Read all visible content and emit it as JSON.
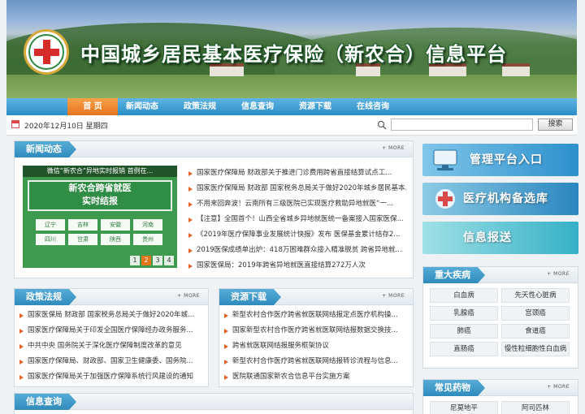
{
  "header": {
    "title": "中国城乡居民基本医疗保险（新农合）信息平台"
  },
  "nav": {
    "items": [
      "首 页",
      "新闻动态",
      "政策法规",
      "信息查询",
      "资源下载",
      "在线咨询"
    ]
  },
  "toolbar": {
    "date": "2020年12月10日 星期四",
    "search_placeholder": "",
    "search_button": "搜索"
  },
  "more_label": "MORE",
  "news": {
    "title": "新闻动态",
    "image_caption": "微信“新农合”异地实时报销 首例在...",
    "image_board": [
      "新农合跨省就医",
      "实时结报"
    ],
    "image_cells": [
      "辽宁",
      "吉林",
      "安徽",
      "河南",
      "四川",
      "甘肃",
      "陕西",
      "贵州"
    ],
    "pager": [
      "1",
      "2",
      "3",
      "4"
    ],
    "items": [
      "国家医疗保障局 财政部关于推进门诊费用跨省直接结算试点工...",
      "国家医疗保障局 财政部 国家税务总局关于做好2020年城乡居民基本...",
      "不用来回奔波！云南所有三级医院已实现医疗救助异地就医“一...",
      "【注意】全国首个！山西全省城乡异地就医统一备案接入国家医保...",
      "《2019年医疗保障事业发展统计快报》发布 医保基金累计结存2...",
      "2019医保成绩单出炉：418万困难群众接入精准脱贫 跨省异地就...",
      "国家医保局：2019年跨省异地就医直接结算272万人次"
    ]
  },
  "policy": {
    "title": "政策法规",
    "items": [
      "国家医保局 财政部 国家税务总局关于做好2020年城...",
      "国家医疗保障局关于印发全国医疗保障经办政务服务...",
      "中共中央 国务院关于深化医疗保障制度改革的意见",
      "国家医疗保障局、财政部、国家卫生健康委、国务院...",
      "国家医疗保障局关于加强医疗保障系统行风建设的通知"
    ]
  },
  "download": {
    "title": "资源下载",
    "items": [
      "新型农村合作医疗跨省就医联网结报定点医疗机构操...",
      "国家新型农村合作医疗跨省就医联网结报数据交换技...",
      "跨省就医联网结报服务框架协议",
      "新型农村合作医疗跨省就医联网结报转诊流程与信息...",
      "医院联通国家新农合信息平台实施方案"
    ]
  },
  "query": {
    "title": "信息查询"
  },
  "sidebar": {
    "buttons": [
      "管理平台入口",
      "医疗机构备选库",
      "信息报送"
    ],
    "diseases": {
      "title": "重大疾病",
      "items": [
        "白血病",
        "先天性心脏病",
        "乳腺癌",
        "宫颈癌",
        "肺癌",
        "食道癌",
        "直肠癌",
        "慢性粒细胞性白血病"
      ]
    },
    "drugs": {
      "title": "常见药物",
      "items": [
        "尼莫地平",
        "阿司匹林"
      ]
    }
  },
  "colors": {
    "nav_blue": "#2a8dc6",
    "nav_active": "#e5731c",
    "panel_tab": "#2f8bbd",
    "bullet": "#e2622a"
  }
}
